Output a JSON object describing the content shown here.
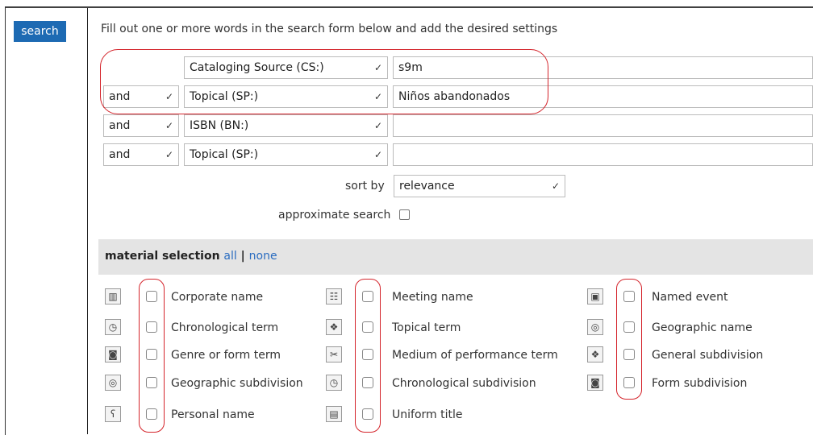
{
  "search_tab": "search",
  "instruction": "Fill out one or more words in the search form below and add the desired settings",
  "rows": [
    {
      "operator": "",
      "field": "Cataloging Source (CS:)",
      "value": "s9m"
    },
    {
      "operator": "and",
      "field": "Topical (SP:)",
      "value": "Niños abandonados"
    },
    {
      "operator": "and",
      "field": "ISBN (BN:)",
      "value": ""
    },
    {
      "operator": "and",
      "field": "Topical (SP:)",
      "value": ""
    }
  ],
  "sort": {
    "label": "sort by",
    "value": "relevance"
  },
  "approximate": {
    "label": "approximate search"
  },
  "material": {
    "title": "material selection",
    "all": "all",
    "sep": "|",
    "none": "none"
  },
  "types": [
    [
      "Corporate name",
      "Meeting name",
      "Named event"
    ],
    [
      "Chronological term",
      "Topical term",
      "Geographic name"
    ],
    [
      "Genre or form term",
      "Medium of performance term",
      "General subdivision"
    ],
    [
      "Geographic subdivision",
      "Chronological subdivision",
      "Form subdivision"
    ],
    [
      "Personal name",
      "Uniform title"
    ]
  ],
  "icons": [
    [
      "building-icon",
      "meeting-icon",
      "event-icon"
    ],
    [
      "clock-icon",
      "topic-icon",
      "globe-icon"
    ],
    [
      "genre-icon",
      "instrument-icon",
      "topic-icon"
    ],
    [
      "globe-icon",
      "clock-icon",
      "form-icon"
    ],
    [
      "person-icon",
      "book-icon"
    ]
  ],
  "icon_glyphs": {
    "building-icon": "▥",
    "meeting-icon": "☷",
    "event-icon": "▣",
    "clock-icon": "◷",
    "topic-icon": "❖",
    "globe-icon": "◎",
    "genre-icon": "◙",
    "instrument-icon": "✂",
    "form-icon": "◙",
    "person-icon": "ʕ",
    "book-icon": "▤"
  },
  "colors": {
    "tab": "#1d6ab3",
    "link": "#2a6cc0",
    "annotation": "#d4242b"
  }
}
